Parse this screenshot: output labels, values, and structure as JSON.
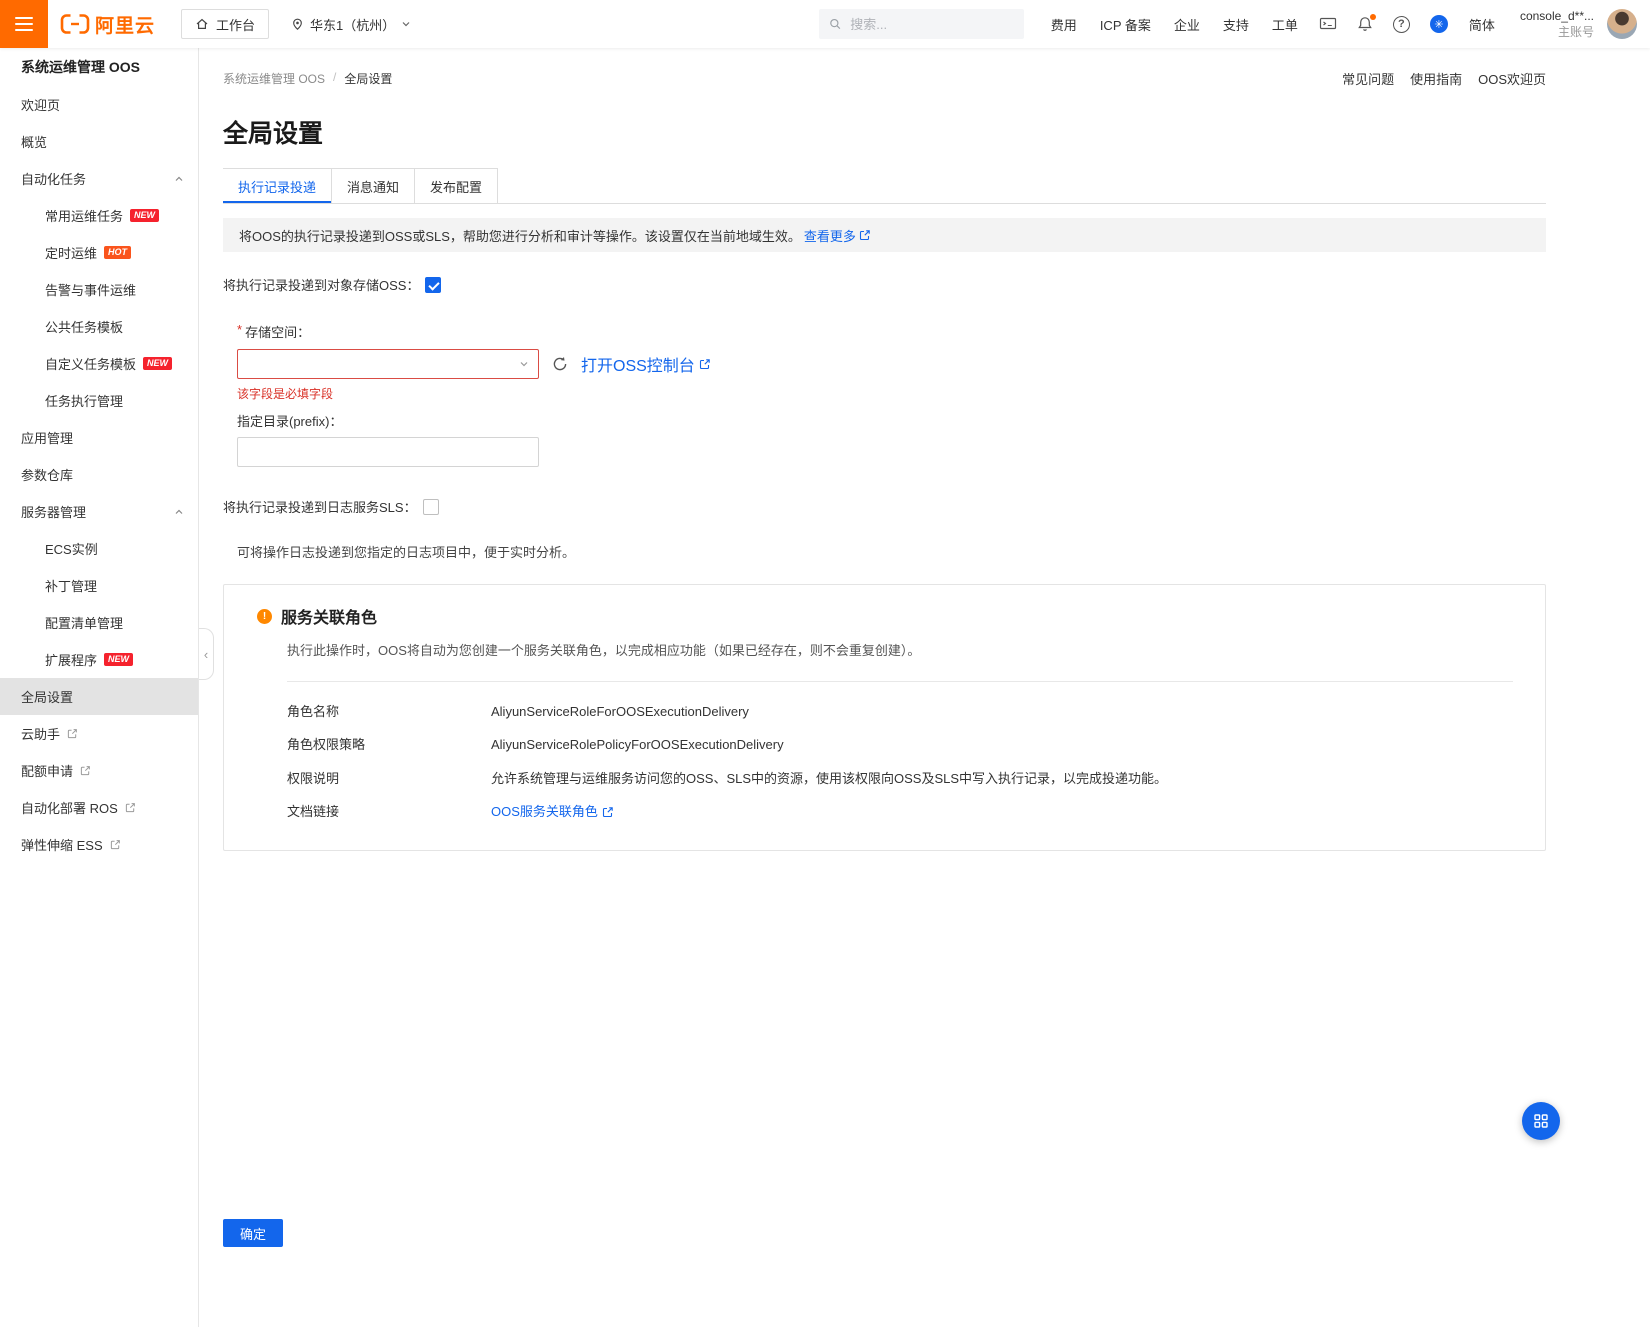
{
  "colors": {
    "brand_orange": "#FF6A00",
    "accent_blue": "#1366EC",
    "error_red": "#D93026",
    "badge_new": "#F5222D",
    "badge_hot": "#FA541C"
  },
  "glyphs": {
    "help": "?",
    "warning": "!",
    "collapse": "‹",
    "assist": "✳",
    "breadcrumb_sep": "/",
    "required": "*"
  },
  "topbar": {
    "logo": "阿里云",
    "workbench": "工作台",
    "region": "华东1（杭州）",
    "search_placeholder": "搜索...",
    "menu": [
      "费用",
      "ICP 备案",
      "企业",
      "支持",
      "工单"
    ],
    "lang": "简体",
    "account": {
      "name": "console_d**...",
      "type": "主账号"
    }
  },
  "sidebar": {
    "title": "系统运维管理 OOS",
    "items": [
      {
        "label": "欢迎页"
      },
      {
        "label": "概览"
      },
      {
        "label": "自动化任务",
        "group": true
      },
      {
        "label": "常用运维任务",
        "classes": "sub",
        "badge": "NEW"
      },
      {
        "label": "定时运维",
        "classes": "sub",
        "badge": "HOT"
      },
      {
        "label": "告警与事件运维",
        "classes": "sub"
      },
      {
        "label": "公共任务模板",
        "classes": "sub"
      },
      {
        "label": "自定义任务模板",
        "classes": "sub",
        "badge": "NEW"
      },
      {
        "label": "任务执行管理",
        "classes": "sub"
      },
      {
        "label": "应用管理"
      },
      {
        "label": "参数仓库"
      },
      {
        "label": "服务器管理",
        "group": true
      },
      {
        "label": "ECS实例",
        "classes": "sub"
      },
      {
        "label": "补丁管理",
        "classes": "sub"
      },
      {
        "label": "配置清单管理",
        "classes": "sub"
      },
      {
        "label": "扩展程序",
        "classes": "sub",
        "badge": "NEW"
      },
      {
        "label": "全局设置",
        "classes": "active"
      },
      {
        "label": "云助手",
        "external": true
      },
      {
        "label": "配额申请",
        "external": true
      },
      {
        "label": "自动化部署 ROS",
        "external": true
      },
      {
        "label": "弹性伸缩 ESS",
        "external": true
      }
    ]
  },
  "breadcrumb": [
    "系统运维管理 OOS",
    "全局设置"
  ],
  "header_links": [
    "常见问题",
    "使用指南",
    "OOS欢迎页"
  ],
  "page_title": "全局设置",
  "tabs": [
    {
      "label": "执行记录投递",
      "classes": "active"
    },
    {
      "label": "消息通知"
    },
    {
      "label": "发布配置"
    }
  ],
  "banner": {
    "text": "将OOS的执行记录投递到OSS或SLS，帮助您进行分析和审计等操作。该设置仅在当前地域生效。",
    "link": "查看更多"
  },
  "oss": {
    "toggle_label": "将执行记录投递到对象存储OSS：",
    "bucket_label": "存储空间：",
    "bucket_error": "该字段是必填字段",
    "console_link": "打开OSS控制台",
    "prefix_label": "指定目录(prefix)："
  },
  "sls": {
    "toggle_label": "将执行记录投递到日志服务SLS：",
    "hint": "可将操作日志投递到您指定的日志项目中，便于实时分析。"
  },
  "role_card": {
    "title": "服务关联角色",
    "desc": "执行此操作时，OOS将自动为您创建一个服务关联角色，以完成相应功能（如果已经存在，则不会重复创建）。",
    "rows": [
      {
        "label": "角色名称",
        "value": "AliyunServiceRoleForOOSExecutionDelivery"
      },
      {
        "label": "角色权限策略",
        "value": "AliyunServiceRolePolicyForOOSExecutionDelivery"
      },
      {
        "label": "权限说明",
        "value": "允许系统管理与运维服务访问您的OSS、SLS中的资源，使用该权限向OSS及SLS中写入执行记录，以完成投递功能。"
      },
      {
        "label": "文档链接",
        "value": "OOS服务关联角色",
        "link": true
      }
    ]
  },
  "submit_label": "确定"
}
